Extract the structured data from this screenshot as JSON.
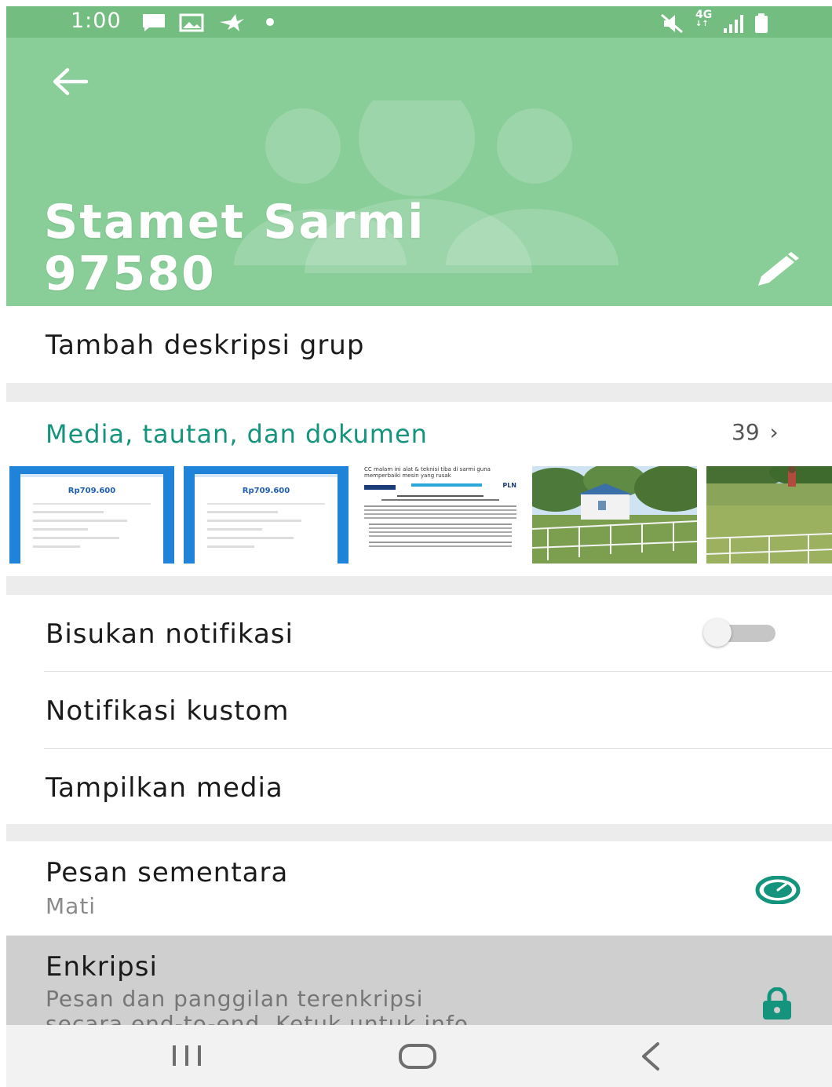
{
  "status_bar": {
    "time": "1:00",
    "left_icons": [
      "message-icon",
      "image-icon",
      "bird-icon",
      "dot-icon"
    ],
    "right_icons": [
      "mute-icon",
      "4g-icon",
      "signal-icon",
      "battery-icon"
    ],
    "network_label": "4G"
  },
  "header": {
    "title_line1": "Stamet Sarmi",
    "title_line2": "97580",
    "background_color": "#89cd98",
    "back_icon": "arrow-left-icon",
    "edit_icon": "pencil-icon"
  },
  "description": {
    "label": "Tambah deskripsi grup"
  },
  "media": {
    "title": "Media, tautan, dan dokumen",
    "count": "39",
    "accent_color": "#14947c",
    "thumbnails": [
      {
        "kind": "receipt-screenshot",
        "amount": "Rp709.600"
      },
      {
        "kind": "receipt-screenshot",
        "amount": "Rp709.600"
      },
      {
        "kind": "document",
        "caption": "CC malam ini alat & teknisi tiba di sarmi guna memperbaiki mesin yang rusak",
        "brand": "PLN"
      },
      {
        "kind": "photo",
        "subject": "station building behind fence"
      },
      {
        "kind": "photo",
        "subject": "person in grass field"
      }
    ]
  },
  "notifications": {
    "mute_label": "Bisukan notifikasi",
    "mute_enabled": false,
    "custom_label": "Notifikasi kustom",
    "media_visibility_label": "Tampilkan media"
  },
  "disappearing": {
    "label": "Pesan sementara",
    "value": "Mati",
    "icon": "timer-icon"
  },
  "encryption": {
    "label": "Enkripsi",
    "description_line1": "Pesan dan panggilan terenkripsi",
    "description_line2": "secara end-to-end. Ketuk untuk info",
    "icon": "lock-icon"
  },
  "nav_bar": {
    "buttons": [
      "recents-icon",
      "home-icon",
      "back-icon"
    ]
  }
}
